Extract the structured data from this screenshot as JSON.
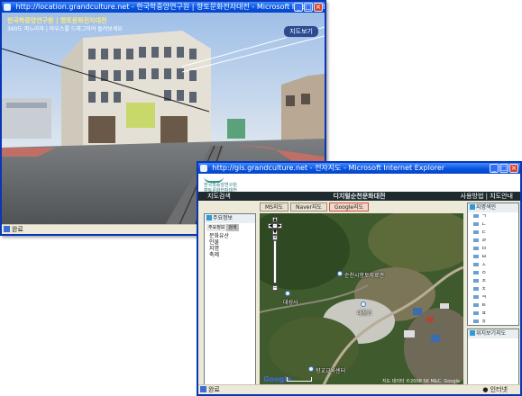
{
  "back_window": {
    "title": "http://location.grandculture.net - 한국학중앙연구원 | 향토문화전자대전 - Microsoft Internet Explorer",
    "pano_caption_line1": "한국학중앙연구원 | 향토문화전자대전",
    "pano_caption_line2": "360도 파노라마 | 마우스를 드래그하여 돌려보세요",
    "pano_button": "지도보기",
    "status": "완료"
  },
  "front_window": {
    "title": "http://gis.grandculture.net - 전자지도 - Microsoft Internet Explorer",
    "site_logo": "한국학중앙연구원 향토문화전자대전",
    "nav_left": "지도검색",
    "site_title": "디지털순천문화대전",
    "nav_right": "사용방법 | 지도안내",
    "map_tabs": [
      {
        "label": "MS지도",
        "selected": false
      },
      {
        "label": "Naver지도",
        "selected": false
      },
      {
        "label": "Google지도",
        "selected": true
      }
    ],
    "left_panel": {
      "heading": "주요정보",
      "tabs": [
        {
          "label": "주요정보",
          "selected": true
        },
        {
          "label": "검색",
          "selected": false
        }
      ],
      "items": [
        "문화유산",
        "인물",
        "지명",
        "축제"
      ]
    },
    "map": {
      "labels": [
        {
          "text": "순천시향토자료관"
        },
        {
          "text": "대성사"
        },
        {
          "text": "대청교"
        },
        {
          "text": "향교교육센터"
        }
      ],
      "google_logo": "Google",
      "copyright": "지도 데이터 ©2008 SK M&C, Google"
    },
    "index_panel": {
      "heading": "지명색인",
      "rows": [
        "ㄱ",
        "ㄴ",
        "ㄷ",
        "ㄹ",
        "ㅁ",
        "ㅂ",
        "ㅅ",
        "ㅇ",
        "ㅈ",
        "ㅊ",
        "ㅋ",
        "ㅌ",
        "ㅍ",
        "ㅎ"
      ]
    },
    "overview_panel": {
      "heading": "위치보기지도"
    },
    "status": "완료",
    "status_zone": "인터넷"
  }
}
